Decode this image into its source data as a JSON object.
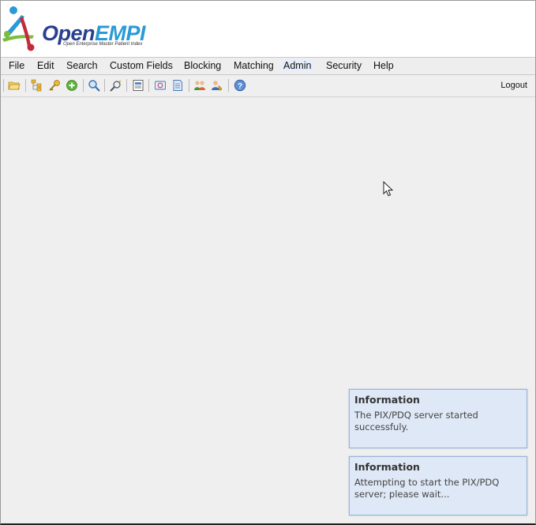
{
  "app": {
    "logo": {
      "name_part1": "Open",
      "name_part2": "EMPI",
      "tagline": "Open Enterprise Master Patient Index"
    }
  },
  "menu": {
    "items": [
      {
        "label": "File"
      },
      {
        "label": "Edit"
      },
      {
        "label": "Search"
      },
      {
        "label": "Custom Fields"
      },
      {
        "label": "Blocking"
      },
      {
        "label": "Matching"
      },
      {
        "label": "Admin",
        "active": true
      },
      {
        "label": "Security"
      },
      {
        "label": "Help"
      }
    ]
  },
  "toolbar": {
    "logout_label": "Logout",
    "icons": [
      "open-folder-icon",
      "tree-icon",
      "key-icon",
      "add-icon",
      "search-icon",
      "magic-search-icon",
      "report-icon",
      "stamp-icon",
      "document-icon",
      "users-icon",
      "user-edit-icon",
      "help-icon"
    ]
  },
  "notifications": [
    {
      "title": "Information",
      "message": "The PIX/PDQ server started successfuly."
    },
    {
      "title": "Information",
      "message": "Attempting to start the PIX/PDQ server; please wait..."
    }
  ],
  "colors": {
    "accent_blue": "#2a9ad6",
    "brand_navy": "#2b3f8f",
    "notice_bg": "#dfe8f6",
    "notice_border": "#99b2d5"
  }
}
